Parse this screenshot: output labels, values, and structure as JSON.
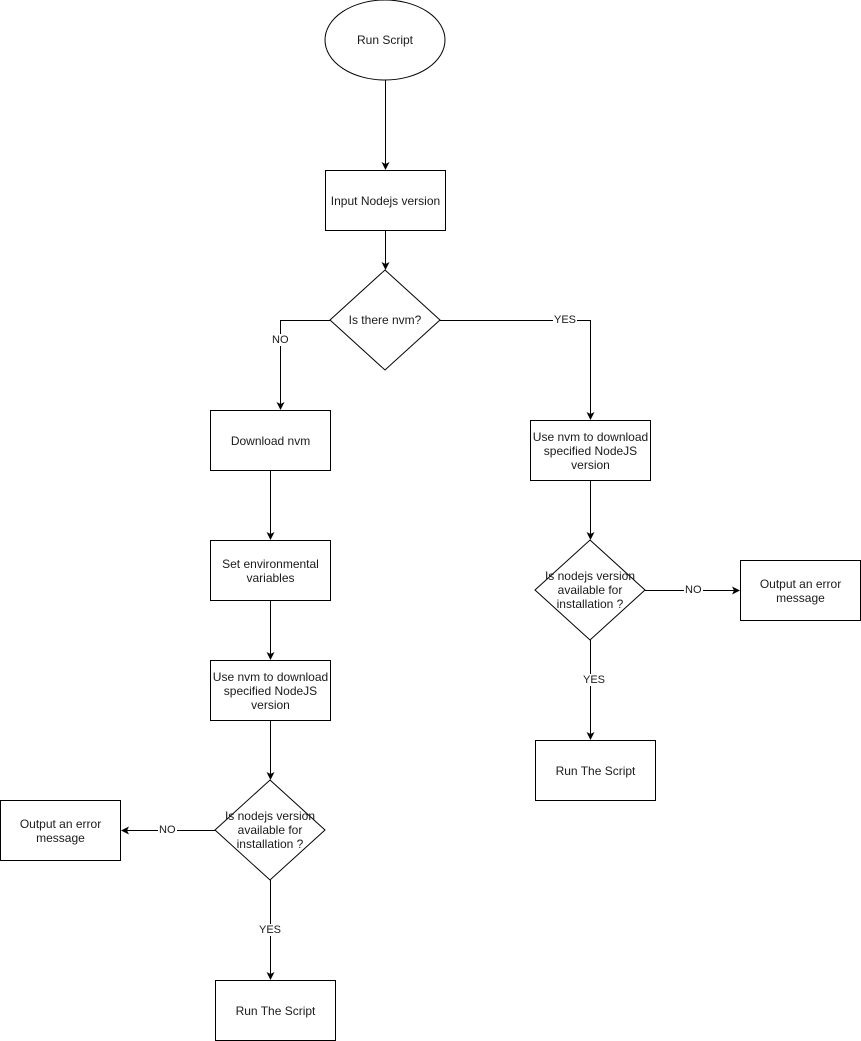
{
  "diagram": {
    "type": "flowchart",
    "nodes": {
      "start": {
        "shape": "ellipse",
        "text": "Run Script"
      },
      "input": {
        "shape": "rect",
        "text": "Input Nodejs version"
      },
      "has_nvm": {
        "shape": "diamond",
        "text": "Is there nvm?"
      },
      "download_nvm": {
        "shape": "rect",
        "text": "Download nvm"
      },
      "set_env": {
        "shape": "rect",
        "text": "Set environmental variables"
      },
      "left_use_nvm": {
        "shape": "rect",
        "text": "Use nvm to download specified NodeJS version"
      },
      "left_available": {
        "shape": "diamond",
        "text": "Is nodejs version available for installation ?"
      },
      "left_error": {
        "shape": "rect",
        "text": "Output an error message"
      },
      "left_run": {
        "shape": "rect",
        "text": "Run The Script"
      },
      "right_use_nvm": {
        "shape": "rect",
        "text": "Use nvm to download specified NodeJS version"
      },
      "right_available": {
        "shape": "diamond",
        "text": "Is nodejs version available for installation ?"
      },
      "right_error": {
        "shape": "rect",
        "text": "Output an error message"
      },
      "right_run": {
        "shape": "rect",
        "text": "Run The Script"
      }
    },
    "edges": [
      {
        "from": "start",
        "to": "input",
        "label": ""
      },
      {
        "from": "input",
        "to": "has_nvm",
        "label": ""
      },
      {
        "from": "has_nvm",
        "to": "download_nvm",
        "label": "NO"
      },
      {
        "from": "has_nvm",
        "to": "right_use_nvm",
        "label": "YES"
      },
      {
        "from": "download_nvm",
        "to": "set_env",
        "label": ""
      },
      {
        "from": "set_env",
        "to": "left_use_nvm",
        "label": ""
      },
      {
        "from": "left_use_nvm",
        "to": "left_available",
        "label": ""
      },
      {
        "from": "left_available",
        "to": "left_error",
        "label": "NO"
      },
      {
        "from": "left_available",
        "to": "left_run",
        "label": "YES"
      },
      {
        "from": "right_use_nvm",
        "to": "right_available",
        "label": ""
      },
      {
        "from": "right_available",
        "to": "right_error",
        "label": "NO"
      },
      {
        "from": "right_available",
        "to": "right_run",
        "label": "YES"
      }
    ],
    "colors": {
      "stroke": "#000000",
      "fill": "#ffffff",
      "text": "#1a1a1a"
    }
  }
}
